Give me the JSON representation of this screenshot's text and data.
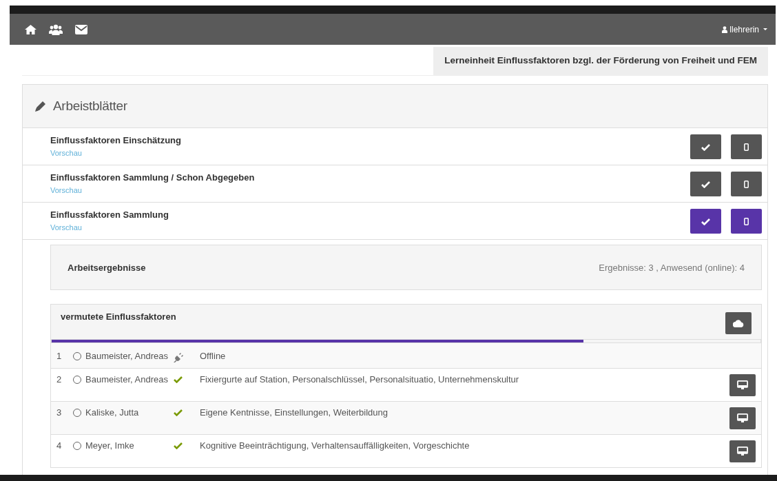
{
  "navbar": {
    "user": "llehrerin"
  },
  "unit_title": "Lerneinheit Einflussfaktoren bzgl. der Förderung von Freiheit und FEM",
  "worksheets": {
    "title": "Arbeistblätter",
    "items": [
      {
        "title": "Einflussfaktoren Einschätzung",
        "link": "Vorschau",
        "selected": false
      },
      {
        "title": "Einflussfaktoren Sammlung / Schon Abgegeben",
        "link": "Vorschau",
        "selected": false
      },
      {
        "title": "Einflussfaktoren Sammlung",
        "link": "Vorschau",
        "selected": true
      }
    ]
  },
  "results": {
    "title": "Arbeitsergebnisse",
    "summary": "Ergebnisse: 3 , Anwesend (online): 4"
  },
  "task": {
    "title": "vermutete Einflussfaktoren",
    "level": 0.75,
    "rows": [
      {
        "number": "1",
        "name": "Baumeister, Andreas",
        "selected": false,
        "kind": "offline",
        "answer": "Offline"
      },
      {
        "number": "2",
        "name": "Baumeister, Andreas",
        "selected": false,
        "kind": "submitted",
        "answer": "Fixiergurte auf Station, Personalschlüssel, Personalsituatio, Unternehmenskultur"
      },
      {
        "number": "3",
        "name": "Kaliske, Jutta",
        "selected": false,
        "kind": "submitted",
        "answer": "Eigene Kentnisse, Einstellungen, Weiterbildung"
      },
      {
        "number": "4",
        "name": "Meyer, Imke",
        "selected": false,
        "kind": "submitted",
        "answer": "Kognitive Beeinträchtigung, Verhaltensauffälligkeiten, Vorgeschichte"
      }
    ]
  }
}
